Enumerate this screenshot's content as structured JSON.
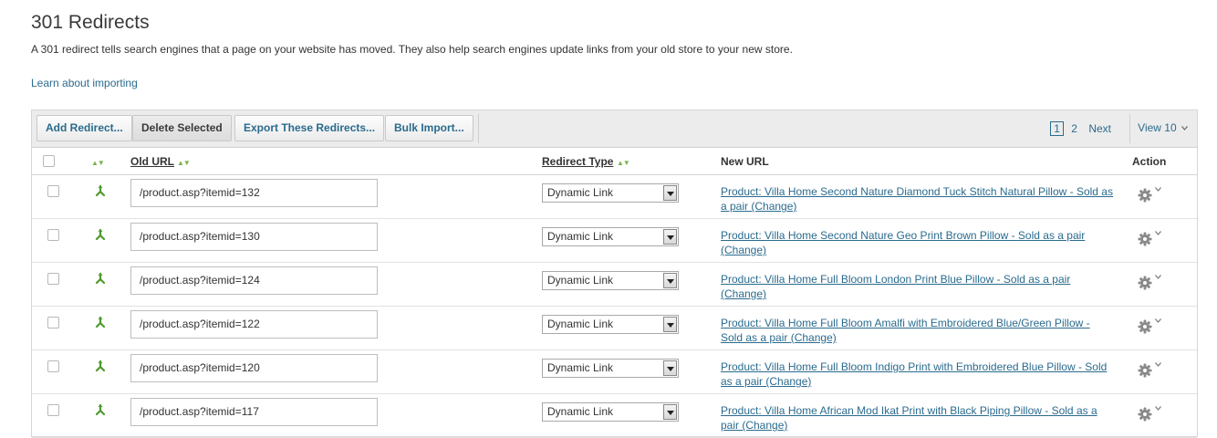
{
  "page": {
    "title": "301 Redirects",
    "intro": "A 301 redirect tells search engines that a page on your website has moved. They also help search engines update links from your old store to your new store.",
    "learn_link": "Learn about importing"
  },
  "toolbar": {
    "add_label": "Add Redirect...",
    "delete_label": "Delete Selected",
    "export_label": "Export These Redirects...",
    "bulk_label": "Bulk Import..."
  },
  "pagination": {
    "pages": [
      "1",
      "2"
    ],
    "current": "1",
    "next_label": "Next",
    "view_label": "View 10"
  },
  "table": {
    "headers": {
      "old_url": "Old URL",
      "redirect_type": "Redirect Type",
      "new_url": "New URL",
      "action": "Action"
    },
    "rows": [
      {
        "old_url": "/product.asp?itemid=132",
        "type": "Dynamic Link",
        "new_url": "Product: Villa Home Second Nature Diamond Tuck Stitch Natural Pillow - Sold as a pair (Change)"
      },
      {
        "old_url": "/product.asp?itemid=130",
        "type": "Dynamic Link",
        "new_url": "Product: Villa Home Second Nature Geo Print Brown Pillow - Sold as a pair (Change)"
      },
      {
        "old_url": "/product.asp?itemid=124",
        "type": "Dynamic Link",
        "new_url": "Product: Villa Home Full Bloom London Print Blue Pillow - Sold as a pair (Change)"
      },
      {
        "old_url": "/product.asp?itemid=122",
        "type": "Dynamic Link",
        "new_url": "Product: Villa Home Full Bloom Amalfi with Embroidered Blue/Green Pillow - Sold as a pair (Change)"
      },
      {
        "old_url": "/product.asp?itemid=120",
        "type": "Dynamic Link",
        "new_url": "Product: Villa Home Full Bloom Indigo Print with Embroidered Blue Pillow - Sold as a pair (Change)"
      },
      {
        "old_url": "/product.asp?itemid=117",
        "type": "Dynamic Link",
        "new_url": "Product: Villa Home African Mod Ikat Print with Black Piping Pillow - Sold as a pair (Change)"
      }
    ]
  },
  "colors": {
    "link": "#2a6b8e",
    "sort_arrow": "#7ab34a",
    "toolbar_bg": "#ececec"
  },
  "icons": {
    "redirect": "redirect-branch-icon",
    "action": "gear-icon",
    "caret": "chevron-down-icon"
  }
}
